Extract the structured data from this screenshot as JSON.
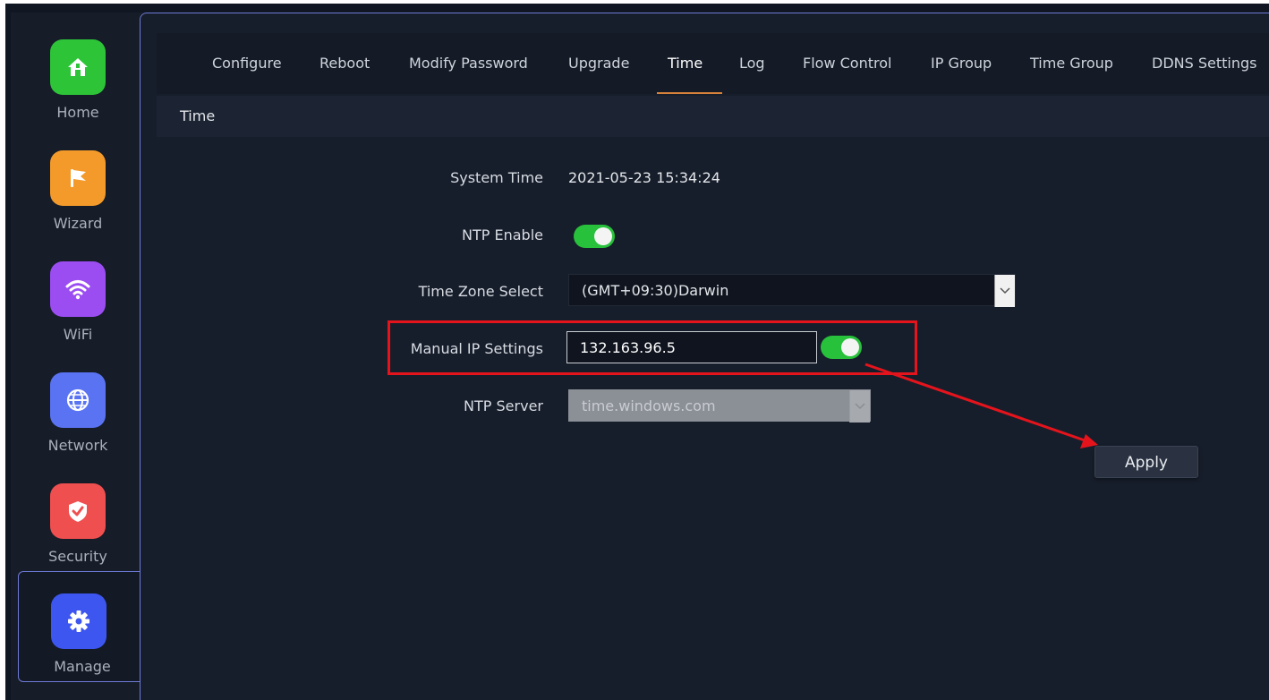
{
  "sidebar": {
    "items": [
      {
        "label": "Home",
        "icon": "home-icon",
        "color": "#2dc438"
      },
      {
        "label": "Wizard",
        "icon": "flag-icon",
        "color": "#f39a2b"
      },
      {
        "label": "WiFi",
        "icon": "wifi-icon",
        "color": "#9b4df2"
      },
      {
        "label": "Network",
        "icon": "globe-icon",
        "color": "#5a73f2"
      },
      {
        "label": "Security",
        "icon": "shield-icon",
        "color": "#ef4f4f"
      },
      {
        "label": "Manage",
        "icon": "gear-icon",
        "color": "#3d56f0",
        "active": true
      }
    ]
  },
  "tabs": [
    {
      "label": "Configure"
    },
    {
      "label": "Reboot"
    },
    {
      "label": "Modify Password"
    },
    {
      "label": "Upgrade"
    },
    {
      "label": "Time",
      "active": true
    },
    {
      "label": "Log"
    },
    {
      "label": "Flow Control"
    },
    {
      "label": "IP Group"
    },
    {
      "label": "Time Group"
    },
    {
      "label": "DDNS Settings"
    }
  ],
  "section": {
    "title": "Time"
  },
  "form": {
    "system_time_label": "System Time",
    "system_time_value": "2021-05-23 15:34:24",
    "ntp_enable_label": "NTP Enable",
    "ntp_enable_on": true,
    "timezone_label": "Time Zone Select",
    "timezone_value": "(GMT+09:30)Darwin",
    "manual_ip_label": "Manual IP Settings",
    "manual_ip_value": "132.163.96.5",
    "manual_ip_on": true,
    "ntp_server_label": "NTP Server",
    "ntp_server_value": "time.windows.com"
  },
  "apply_label": "Apply",
  "colors": {
    "accent_tab": "#d7813a",
    "toggle_on": "#27c13b",
    "annotation_red": "#e5141c"
  }
}
